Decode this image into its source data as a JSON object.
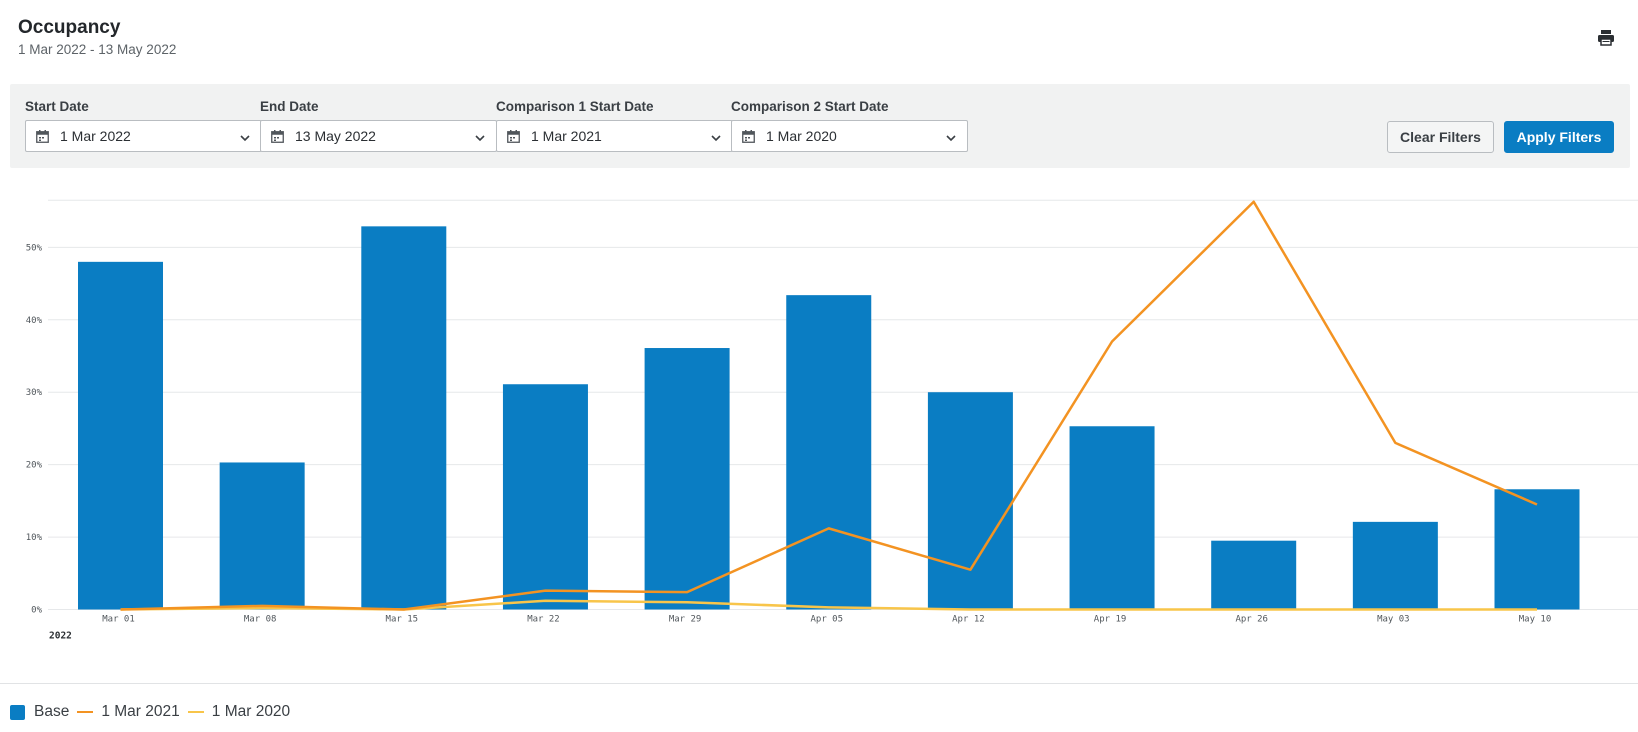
{
  "header": {
    "title": "Occupancy",
    "subtitle": "1 Mar 2022 - 13 May 2022"
  },
  "toolbar": {
    "print_icon": "printer-icon"
  },
  "filters": {
    "start_date": {
      "label": "Start Date",
      "value": "1 Mar 2022"
    },
    "end_date": {
      "label": "End Date",
      "value": "13 May 2022"
    },
    "comparison1": {
      "label": "Comparison 1 Start Date",
      "value": "1 Mar 2021"
    },
    "comparison2": {
      "label": "Comparison 2 Start Date",
      "value": "1 Mar 2020"
    },
    "clear_label": "Clear Filters",
    "apply_label": "Apply Filters",
    "calendar_icon": "calendar-icon",
    "chevron_icon": "chevron-down-icon"
  },
  "colors": {
    "base": "#0a7dc3",
    "comparison1": "#f39322",
    "comparison2": "#f8c54a",
    "grid": "#e6e8ea",
    "apply": "#0a7dc3"
  },
  "chart_data": {
    "type": "bar",
    "categories": [
      "Mar 01",
      "Mar 08",
      "Mar 15",
      "Mar 22",
      "Mar 29",
      "Apr 05",
      "Apr 12",
      "Apr 19",
      "Apr 26",
      "May 03",
      "May 10"
    ],
    "year_label": "2022",
    "y_ticks": [
      "0%",
      "10%",
      "20%",
      "30%",
      "40%",
      "50%"
    ],
    "ylim": [
      0,
      56.5
    ],
    "grid": true,
    "legend_position": "bottom-left",
    "series": [
      {
        "name": "Base",
        "type": "bar",
        "values": [
          48.0,
          20.3,
          52.9,
          31.1,
          36.1,
          43.4,
          30.0,
          25.3,
          9.5,
          12.1,
          16.6
        ]
      },
      {
        "name": "1 Mar 2021",
        "type": "line",
        "values": [
          0.0,
          0.5,
          0.0,
          2.6,
          2.4,
          11.2,
          5.5,
          37.0,
          56.3,
          23.0,
          14.5
        ]
      },
      {
        "name": "1 Mar 2020",
        "type": "line",
        "values": [
          0.0,
          0.2,
          0.0,
          1.2,
          1.0,
          0.3,
          0.0,
          0.0,
          0.0,
          0.0,
          0.0
        ]
      }
    ]
  }
}
